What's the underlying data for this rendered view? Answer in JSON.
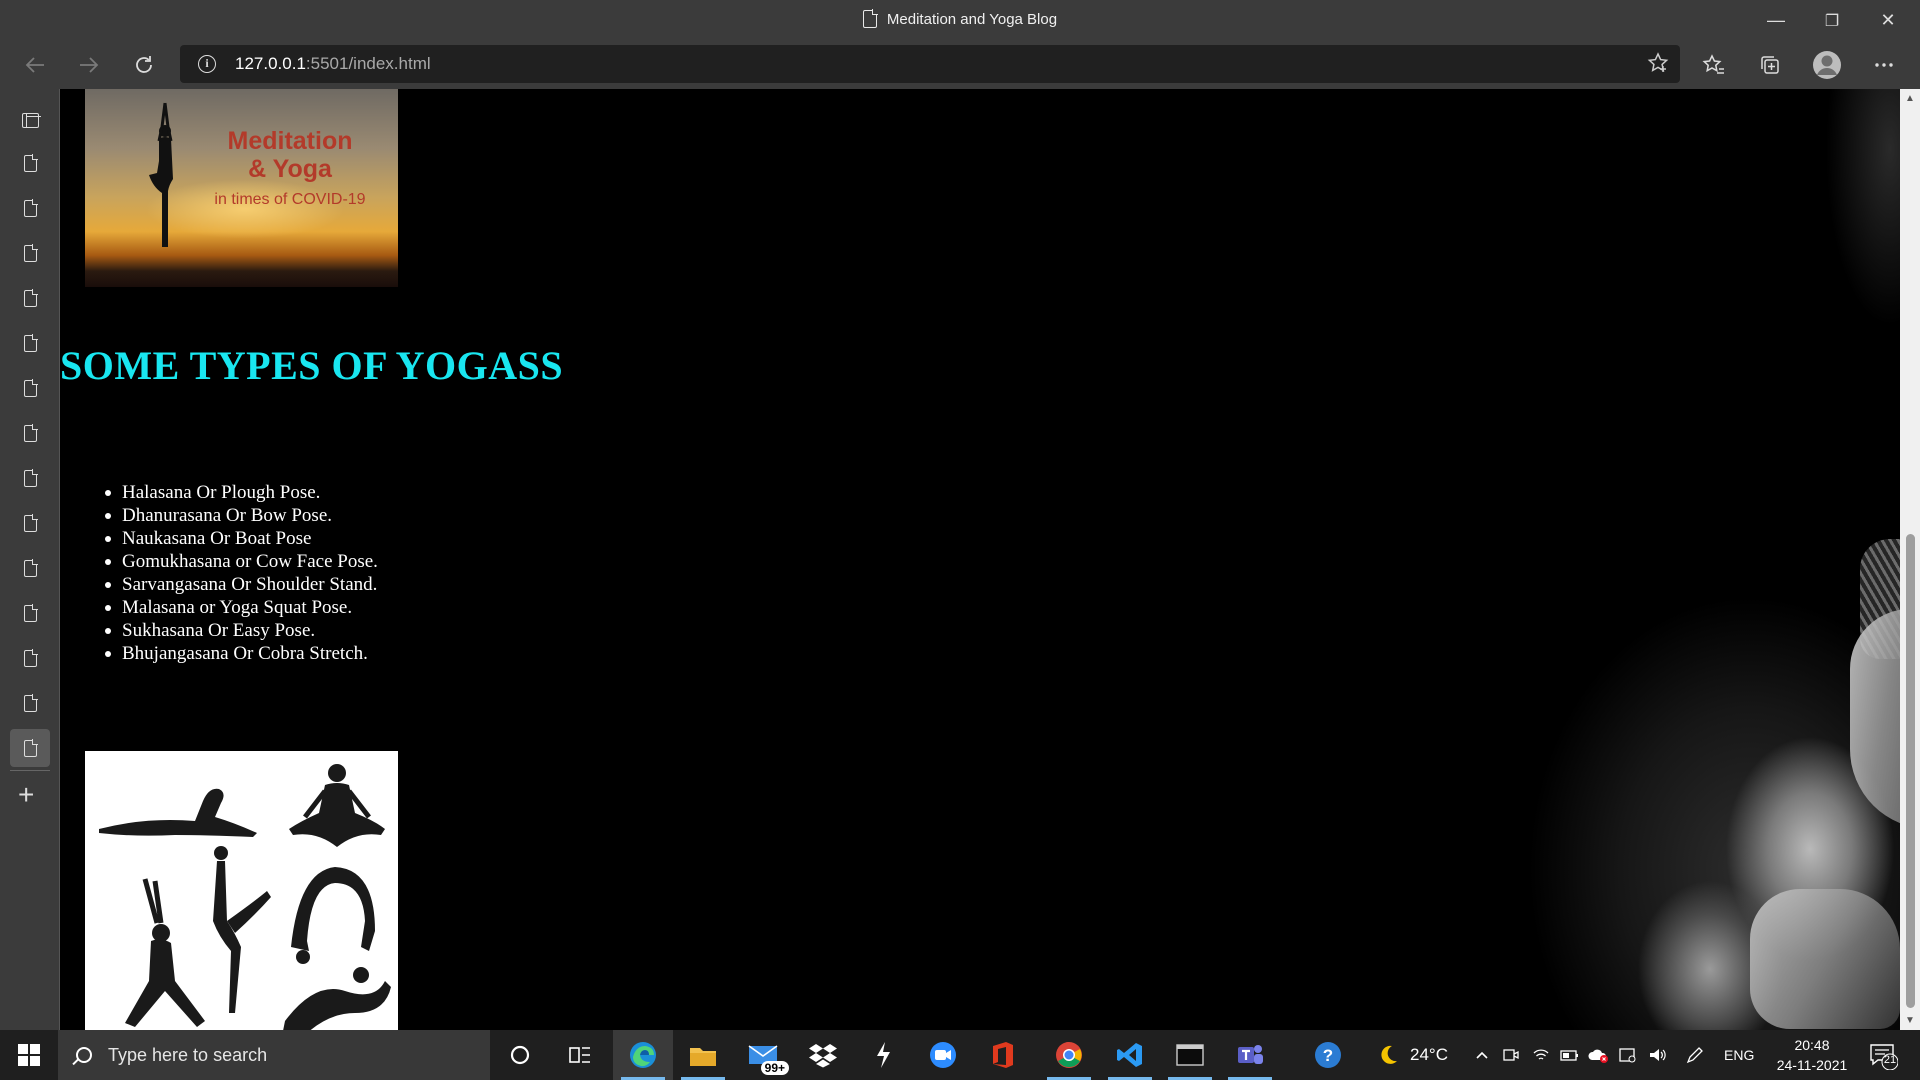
{
  "window": {
    "title": "Meditation and Yoga Blog",
    "minimize_symbol": "—",
    "restore_symbol": "❐",
    "close_symbol": "✕"
  },
  "address_bar": {
    "url_host": "127.0.0.1",
    "url_rest": ":5501/index.html"
  },
  "page": {
    "top_image": {
      "line1": "Meditation",
      "line2": "& Yoga",
      "line3": "in times of COVID-19"
    },
    "heading": "SOME TYPES OF YOGASS",
    "poses": [
      "Halasana Or Plough Pose.",
      "Dhanurasana Or Bow Pose.",
      "Naukasana Or Boat Pose",
      "Gomukhasana or Cow Face Pose.",
      "Sarvangasana Or Shoulder Stand.",
      "Malasana or Yoga Squat Pose.",
      "Sukhasana Or Easy Pose.",
      "Bhujangasana Or Cobra Stretch."
    ]
  },
  "taskbar": {
    "search_placeholder": "Type here to search",
    "mail_badge": "99+",
    "weather": "24°C",
    "language": "ENG",
    "time": "20:48",
    "date": "24-11-2021",
    "notification_count": "21"
  },
  "colors": {
    "heading": "#19e6f0",
    "chrome": "#3b3b3b",
    "taskbar": "#1f1f1f"
  }
}
